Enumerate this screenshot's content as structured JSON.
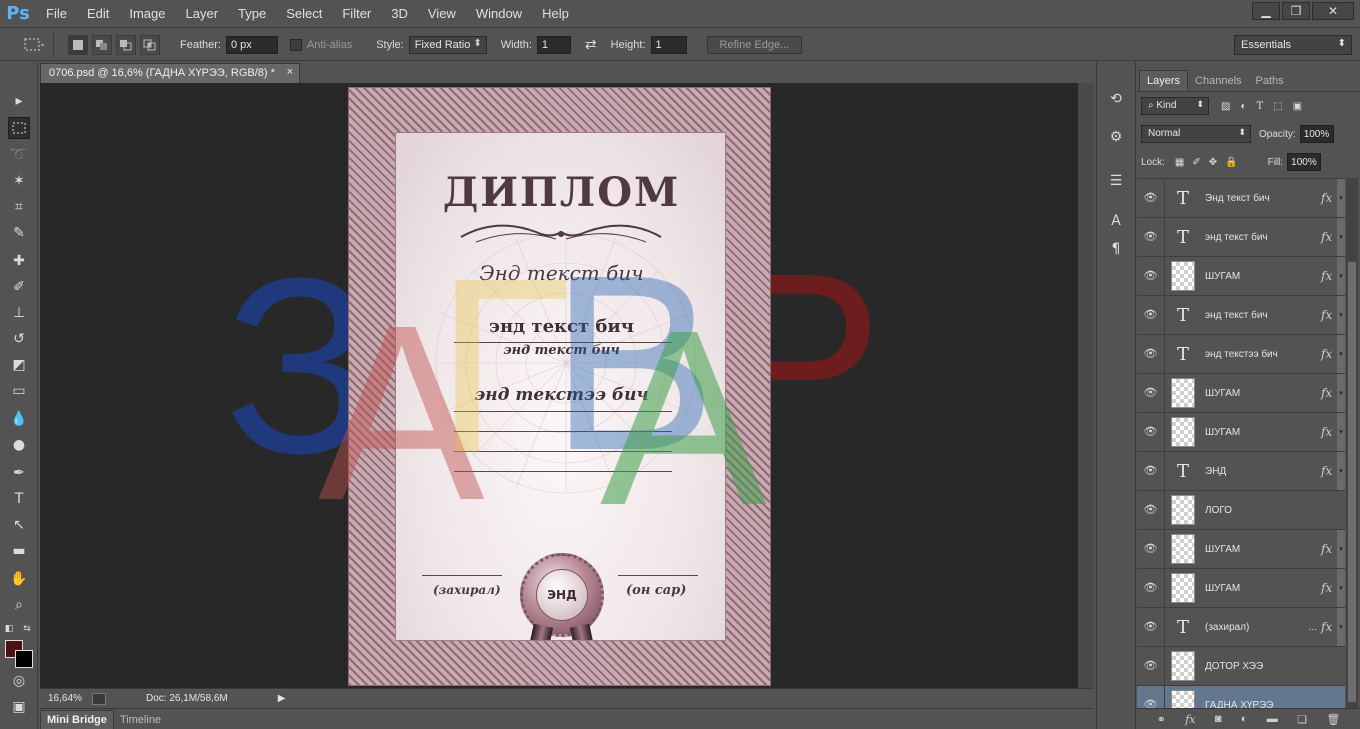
{
  "app": {
    "logo": "Ps"
  },
  "menu": [
    "File",
    "Edit",
    "Image",
    "Layer",
    "Type",
    "Select",
    "Filter",
    "3D",
    "View",
    "Window",
    "Help"
  ],
  "window_controls": {
    "minimize": "▁",
    "restore": "❐",
    "close": "✕"
  },
  "options": {
    "feather_label": "Feather:",
    "feather_value": "0 px",
    "antialias_label": "Anti-alias",
    "style_label": "Style:",
    "style_value": "Fixed Ratio",
    "width_label": "Width:",
    "width_value": "1",
    "swap_icon": "⇄",
    "height_label": "Height:",
    "height_value": "1",
    "refine_edge": "Refine Edge...",
    "workspace": "Essentials"
  },
  "document": {
    "tab_title": "0706.psd @ 16,6% (ГАДНА ХҮРЭЭ, RGB/8) *",
    "tab_close": "×",
    "zoom": "16,64%",
    "doc_size": "Doc: 26,1M/58,6M"
  },
  "watermark": {
    "letters": [
      "З",
      "А",
      "Г",
      "В",
      "А",
      "Р"
    ],
    "colors": [
      "#1f3d8c",
      "#c0504d",
      "#e8c43c",
      "#1f5fb0",
      "#3fa04a",
      "#7a1c1c"
    ]
  },
  "diploma": {
    "title": "ДИПЛОМ",
    "line1": "Энд текст бич",
    "line2": "энд текст бич",
    "line3": "энд текст бич",
    "line4": "энд текстээ бич",
    "seal_text": "ЭНД",
    "sig_left": "(захирал)",
    "sig_right": "(он сар)"
  },
  "bottom_tabs": [
    "Mini Bridge",
    "Timeline"
  ],
  "panel": {
    "tabs": [
      "Layers",
      "Channels",
      "Paths"
    ],
    "kind_label": "Kind",
    "blend_mode": "Normal",
    "opacity_label": "Opacity:",
    "opacity_value": "100%",
    "lock_label": "Lock:",
    "fill_label": "Fill:",
    "fill_value": "100%",
    "fx_label": "fx",
    "dots": "...",
    "layers": [
      {
        "name": "Энд текст бич",
        "kind": "text",
        "fx": true
      },
      {
        "name": "энд текст бич",
        "kind": "text",
        "fx": true
      },
      {
        "name": "ШУГАМ",
        "kind": "pixel",
        "fx": true
      },
      {
        "name": "энд текст бич",
        "kind": "text",
        "fx": true
      },
      {
        "name": "энд текстээ бич",
        "kind": "text",
        "fx": true
      },
      {
        "name": "ШУГАМ",
        "kind": "pixel",
        "fx": true
      },
      {
        "name": "ШУГАМ",
        "kind": "pixel",
        "fx": true
      },
      {
        "name": "ЭНД",
        "kind": "text",
        "fx": true
      },
      {
        "name": "ЛОГО",
        "kind": "pixel",
        "fx": false
      },
      {
        "name": "ШУГАМ",
        "kind": "pixel",
        "fx": true
      },
      {
        "name": "ШУГАМ",
        "kind": "pixel",
        "fx": true
      },
      {
        "name": "(захирал)",
        "kind": "text",
        "fx": true,
        "dots": true
      },
      {
        "name": "ДОТОР ХЭЭ",
        "kind": "pixel",
        "fx": false
      },
      {
        "name": "ГАДНА ХҮРЭЭ",
        "kind": "pixel",
        "fx": false,
        "selected": true
      }
    ],
    "bottom_icons": [
      "link-icon",
      "fx-icon",
      "mask-icon",
      "adjustment-icon",
      "group-icon",
      "new-layer-icon",
      "trash-icon"
    ]
  },
  "colors": {
    "foreground": "#4a1214",
    "background": "#000000",
    "selected_layer": "#63788f"
  }
}
